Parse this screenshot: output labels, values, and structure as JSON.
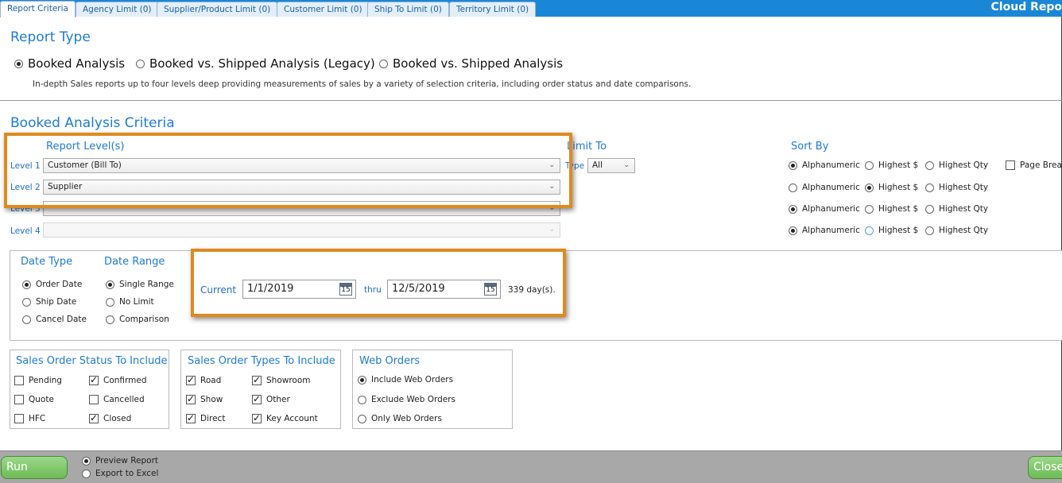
{
  "app_title": "Cloud Repo",
  "tabs": [
    {
      "label": "Report Criteria",
      "active": true
    },
    {
      "label": "Agency Limit (0)"
    },
    {
      "label": "Supplier/Product Limit (0)"
    },
    {
      "label": "Customer Limit (0)"
    },
    {
      "label": "Ship To Limit (0)"
    },
    {
      "label": "Territory Limit (0)"
    }
  ],
  "report_type": {
    "title": "Report Type",
    "options": [
      "Booked Analysis",
      "Booked vs. Shipped Analysis (Legacy)",
      "Booked vs. Shipped Analysis"
    ],
    "selected": "Booked Analysis",
    "description": "In-depth Sales reports up to four levels deep providing measurements of sales by a variety of selection criteria, including order status and date comparisons."
  },
  "criteria": {
    "title": "Booked Analysis Criteria",
    "report_levels_title": "Report Level(s)",
    "levels": [
      {
        "label": "Level 1",
        "value": "Customer (Bill To)"
      },
      {
        "label": "Level 2",
        "value": "Supplier"
      },
      {
        "label": "Level 3",
        "value": ""
      },
      {
        "label": "Level 4",
        "value": ""
      }
    ],
    "limit_to_title": "Limit To",
    "limit_type_label": "Type",
    "limit_type_value": "All",
    "sort_by_title": "Sort By",
    "sort_options": [
      "Alphanumeric",
      "Highest $",
      "Highest Qty"
    ],
    "sort_rows": [
      "Alphanumeric",
      "Highest $",
      "Alphanumeric",
      "Alphanumeric"
    ],
    "page_break_label": "Page Break"
  },
  "dates": {
    "date_type_title": "Date Type",
    "date_type_options": [
      "Order Date",
      "Ship Date",
      "Cancel Date"
    ],
    "date_range_title": "Date Range",
    "date_range_options": [
      "Single Range",
      "No Limit",
      "Comparison"
    ],
    "current_label": "Current",
    "start": "1/1/2019",
    "thru_label": "thru",
    "end": "12/5/2019",
    "calendar_day": "15",
    "days_text": "339 day(s)."
  },
  "status": {
    "title": "Sales Order Status To Include",
    "items": [
      {
        "label": "Pending",
        "checked": false
      },
      {
        "label": "Confirmed",
        "checked": true
      },
      {
        "label": "Quote",
        "checked": false
      },
      {
        "label": "Cancelled",
        "checked": false
      },
      {
        "label": "HFC",
        "checked": false
      },
      {
        "label": "Closed",
        "checked": true
      }
    ]
  },
  "types": {
    "title": "Sales Order Types To Include",
    "items": [
      {
        "label": "Road",
        "checked": true
      },
      {
        "label": "Showroom",
        "checked": true
      },
      {
        "label": "Show",
        "checked": true
      },
      {
        "label": "Other",
        "checked": true
      },
      {
        "label": "Direct",
        "checked": true
      },
      {
        "label": "Key Account",
        "checked": true
      }
    ]
  },
  "web_orders": {
    "title": "Web Orders",
    "options": [
      "Include Web Orders",
      "Exclude Web Orders",
      "Only Web Orders"
    ],
    "selected": "Include Web Orders"
  },
  "footer": {
    "run_label": "Run Report",
    "output_options": [
      "Preview Report",
      "Export to Excel"
    ],
    "selected_output": "Preview Report",
    "close_label": "Close"
  },
  "colors": {
    "accent_blue": "#1e7bd4",
    "highlight_orange": "#e08a1e",
    "button_green": "#6dbb57"
  }
}
